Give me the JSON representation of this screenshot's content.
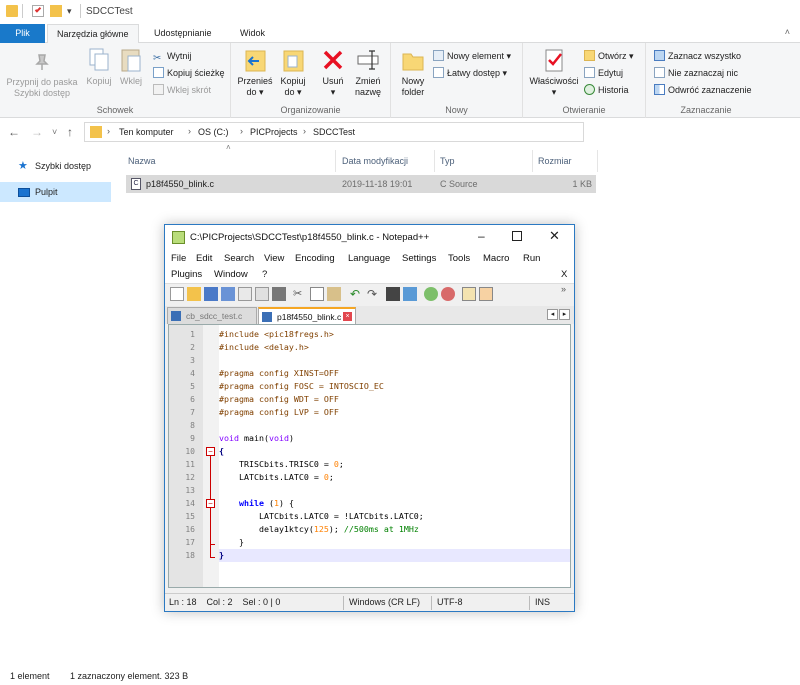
{
  "explorer": {
    "window_title": "SDCCTest",
    "tabs": [
      {
        "label": "Plik"
      },
      {
        "label": "Narzędzia główne"
      },
      {
        "label": "Udostępnianie"
      },
      {
        "label": "Widok"
      }
    ],
    "ribbon": {
      "clipboard": {
        "label": "Schowek",
        "pin": "Przypnij do paska Szybki dostęp",
        "copy": "Kopiuj",
        "paste": "Wklej",
        "cut": "Wytnij",
        "copy_path": "Kopiuj ścieżkę",
        "paste_shortcut": "Wklej skrót"
      },
      "organize": {
        "label": "Organizowanie",
        "move_to": "Przenieś do",
        "copy_to": "Kopiuj do",
        "delete": "Usuń",
        "rename": "Zmień nazwę"
      },
      "new": {
        "label": "Nowy",
        "new_folder": "Nowy folder",
        "new_item": "Nowy element",
        "easy_access": "Łatwy dostęp"
      },
      "open": {
        "label": "Otwieranie",
        "properties": "Właściwości",
        "open": "Otwórz",
        "edit": "Edytuj",
        "history": "Historia"
      },
      "select": {
        "label": "Zaznaczanie",
        "select_all": "Zaznacz wszystko",
        "select_none": "Nie zaznaczaj nic",
        "invert": "Odwróć zaznaczenie"
      }
    },
    "breadcrumb": [
      "Ten komputer",
      "OS (C:)",
      "PICProjects",
      "SDCCTest"
    ],
    "nav": {
      "quick_access": "Szybki dostęp",
      "desktop": "Pulpit"
    },
    "columns": {
      "name": "Nazwa",
      "modified": "Data modyfikacji",
      "type": "Typ",
      "size": "Rozmiar"
    },
    "files": [
      {
        "name": "p18f4550_blink.c",
        "modified": "2019-11-18 19:01",
        "type": "C Source",
        "size": "1 KB"
      }
    ],
    "status": {
      "count": "1 element",
      "selected": "1 zaznaczony element. 323 B"
    }
  },
  "npp": {
    "title": "C:\\PICProjects\\SDCCTest\\p18f4550_blink.c - Notepad++",
    "menu": [
      "File",
      "Edit",
      "Search",
      "View",
      "Encoding",
      "Language",
      "Settings",
      "Tools",
      "Macro",
      "Run",
      "Plugins",
      "Window",
      "?"
    ],
    "close_doc": "X",
    "tabs": [
      {
        "label": "cb_sdcc_test.c"
      },
      {
        "label": "p18f4550_blink.c"
      }
    ],
    "line_numbers": [
      "1",
      "2",
      "3",
      "4",
      "5",
      "6",
      "7",
      "8",
      "9",
      "10",
      "11",
      "12",
      "13",
      "14",
      "15",
      "16",
      "17",
      "18"
    ],
    "code": {
      "l1": "#include <pic18fregs.h>",
      "l2": "#include <delay.h>",
      "l4": "#pragma config XINST=OFF",
      "l5": "#pragma config FOSC = INTOSCIO_EC",
      "l6": "#pragma config WDT = OFF",
      "l7": "#pragma config LVP = OFF",
      "l9a": "void",
      "l9b": " main(",
      "l9c": "void",
      "l9d": ")",
      "l10": "{",
      "l11a": "    TRISCbits.TRISC0 = ",
      "l11b": "0",
      "l11c": ";",
      "l12a": "    LATCbits.LATC0 = ",
      "l12b": "0",
      "l12c": ";",
      "l14a": "    ",
      "l14b": "while",
      "l14c": " (",
      "l14d": "1",
      "l14e": ") {",
      "l15": "        LATCbits.LATC0 = !LATCbits.LATC0;",
      "l16a": "        delay1ktcy(",
      "l16b": "125",
      "l16c": "); ",
      "l16d": "//500ms at 1MHz",
      "l17": "    }",
      "l18": "}"
    },
    "status": {
      "pos": "Ln : 18    Col : 2    Sel : 0 | 0",
      "eol": "Windows (CR LF)",
      "enc": "UTF-8",
      "mode": "INS"
    }
  }
}
